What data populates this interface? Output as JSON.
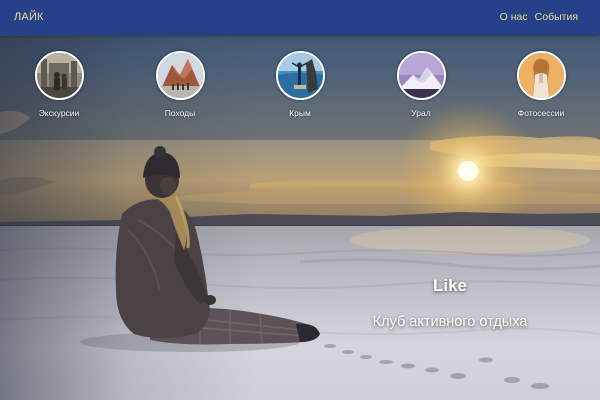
{
  "header": {
    "brand": "ЛАЙК",
    "nav": [
      "О нас",
      "События"
    ]
  },
  "categories": [
    {
      "label": "Экскурсии",
      "icon": "excursions-photo-icon"
    },
    {
      "label": "Походы",
      "icon": "hiking-photo-icon"
    },
    {
      "label": "Крым",
      "icon": "crimea-photo-icon"
    },
    {
      "label": "Урал",
      "icon": "ural-photo-icon"
    },
    {
      "label": "Фотосессии",
      "icon": "photoshoot-photo-icon"
    }
  ],
  "hero": {
    "title": "Like",
    "subtitle": "Клуб активного отдыха"
  },
  "colors": {
    "navbar_bg": "#24418a",
    "nav_text": "#f3dd93",
    "hero_text": "#ffffff",
    "circle_border": "#ffffff"
  }
}
